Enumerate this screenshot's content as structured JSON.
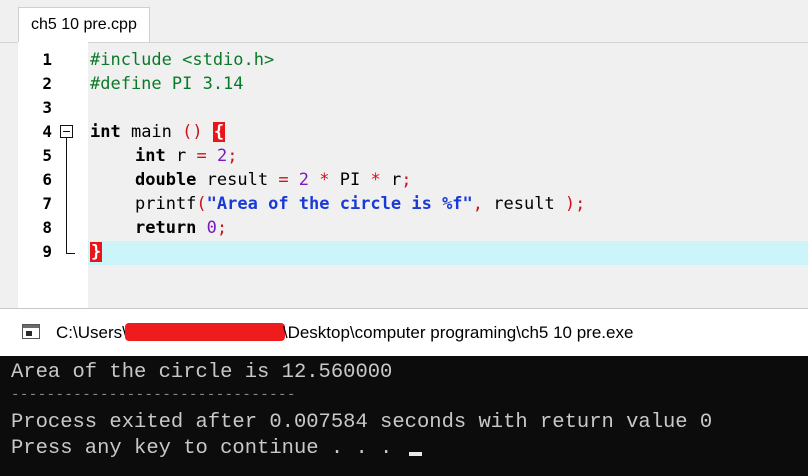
{
  "editor": {
    "tab_label": "ch5 10 pre.cpp",
    "lines": [
      {
        "num": "1"
      },
      {
        "num": "2"
      },
      {
        "num": "3"
      },
      {
        "num": "4"
      },
      {
        "num": "5"
      },
      {
        "num": "6"
      },
      {
        "num": "7"
      },
      {
        "num": "8"
      },
      {
        "num": "9"
      }
    ],
    "code": {
      "l1_pp": "#include <stdio.h>",
      "l2_pp": "#define PI 3.14",
      "l4_kw": "int",
      "l4_id": " main ",
      "l4_op": "()",
      "l4_brace": "{",
      "l5_kw": "int",
      "l5_id": " r ",
      "l5_op": "=",
      "l5_num": "2",
      "l5_semi": ";",
      "l6_kw": "double",
      "l6_id1": " result ",
      "l6_op1": "=",
      "l6_num": " 2 ",
      "l6_op2": "*",
      "l6_id2": " PI ",
      "l6_op3": "*",
      "l6_id3": " r",
      "l6_semi": ";",
      "l7_id1": "printf",
      "l7_op1": "(",
      "l7_str": "\"Area of the circle is %f\"",
      "l7_op2": ",",
      "l7_id2": " result ",
      "l7_op3": ");",
      "l8_kw": "return",
      "l8_num": " 0",
      "l8_semi": ";",
      "l9_brace": "}"
    }
  },
  "console": {
    "title_prefix": "C:\\Users\\",
    "title_suffix": "\\Desktop\\computer programing\\ch5 10 pre.exe",
    "output": [
      "Area of the circle is 12.560000",
      "--------------------------------",
      "Process exited after 0.007584 seconds with return value 0",
      "Press any key to continue . . . "
    ]
  },
  "colors": {
    "preprocessor": "#0a7a28",
    "string": "#1a3ad6",
    "operator": "#d0101a",
    "number": "#7a1ac0",
    "current_line": "#ccf5fa",
    "brace_match": "#e8151a",
    "console_bg": "#0c0c0c",
    "console_fg": "#c8c8c8",
    "redaction": "#ee1c1c"
  }
}
